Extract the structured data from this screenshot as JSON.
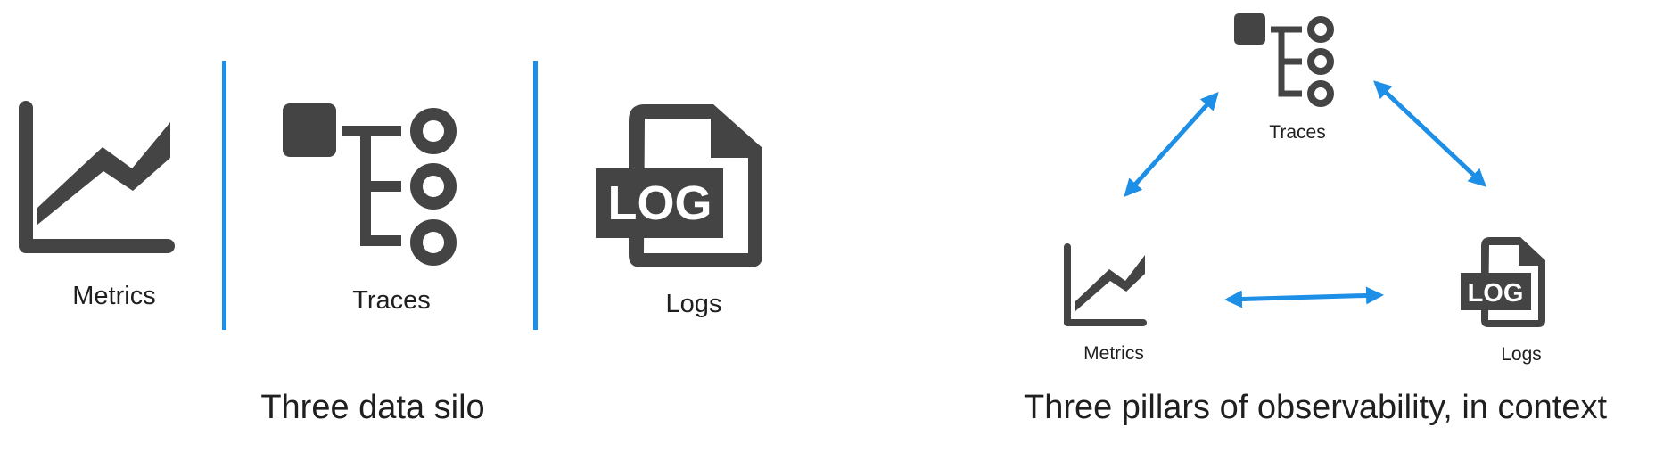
{
  "left_panel": {
    "caption": "Three data silo",
    "metrics_label": "Metrics",
    "traces_label": "Traces",
    "logs_label": "Logs",
    "logs_icon_text": "LOG"
  },
  "right_panel": {
    "caption": "Three pillars of observability, in context",
    "metrics_label": "Metrics",
    "traces_label": "Traces",
    "logs_label": "Logs",
    "logs_icon_text": "LOG"
  },
  "colors": {
    "icon": "#444444",
    "accent": "#1e8fe6"
  },
  "icons": [
    "line-chart-icon",
    "trace-tree-icon",
    "log-file-icon"
  ]
}
